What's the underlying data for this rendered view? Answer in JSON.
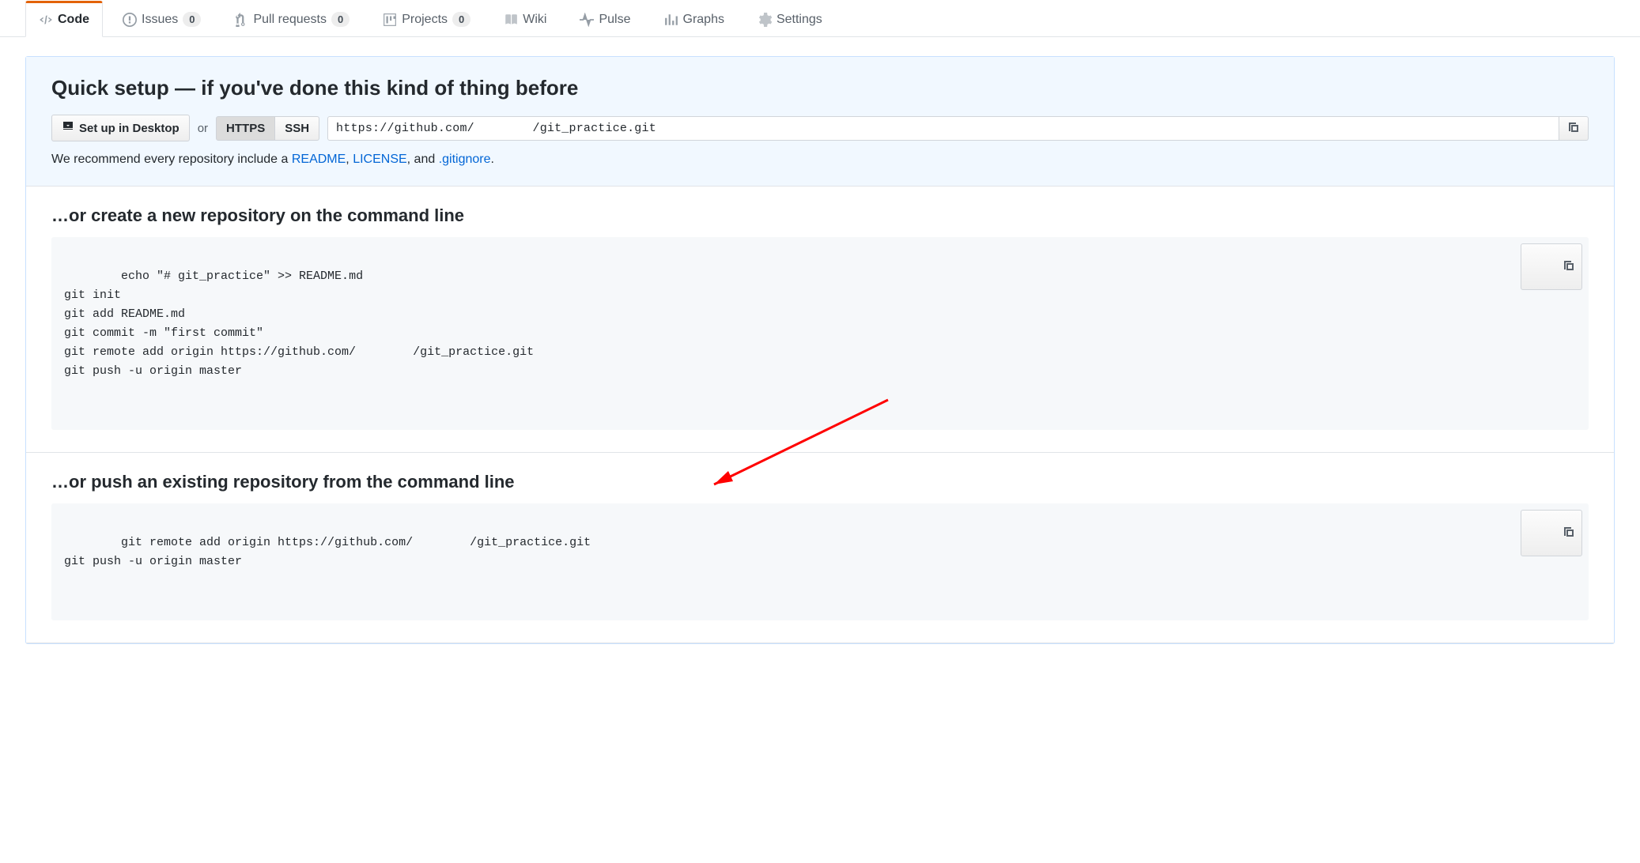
{
  "tabs": {
    "code": "Code",
    "issues": "Issues",
    "issues_count": "0",
    "pulls": "Pull requests",
    "pulls_count": "0",
    "projects": "Projects",
    "projects_count": "0",
    "wiki": "Wiki",
    "pulse": "Pulse",
    "graphs": "Graphs",
    "settings": "Settings"
  },
  "quick": {
    "heading": "Quick setup — if you've done this kind of thing before",
    "desktop_btn": "Set up in Desktop",
    "or": "or",
    "https": "HTTPS",
    "ssh": "SSH",
    "url": "https://github.com/        /git_practice.git",
    "recommend_prefix": "We recommend every repository include a ",
    "readme": "README",
    "comma1": ", ",
    "license": "LICENSE",
    "comma2": ", and ",
    "gitignore": ".gitignore",
    "period": "."
  },
  "create": {
    "heading": "…or create a new repository on the command line",
    "code": "echo \"# git_practice\" >> README.md\ngit init\ngit add README.md\ngit commit -m \"first commit\"\ngit remote add origin https://github.com/        /git_practice.git\ngit push -u origin master"
  },
  "push": {
    "heading": "…or push an existing repository from the command line",
    "code": "git remote add origin https://github.com/        /git_practice.git\ngit push -u origin master"
  }
}
